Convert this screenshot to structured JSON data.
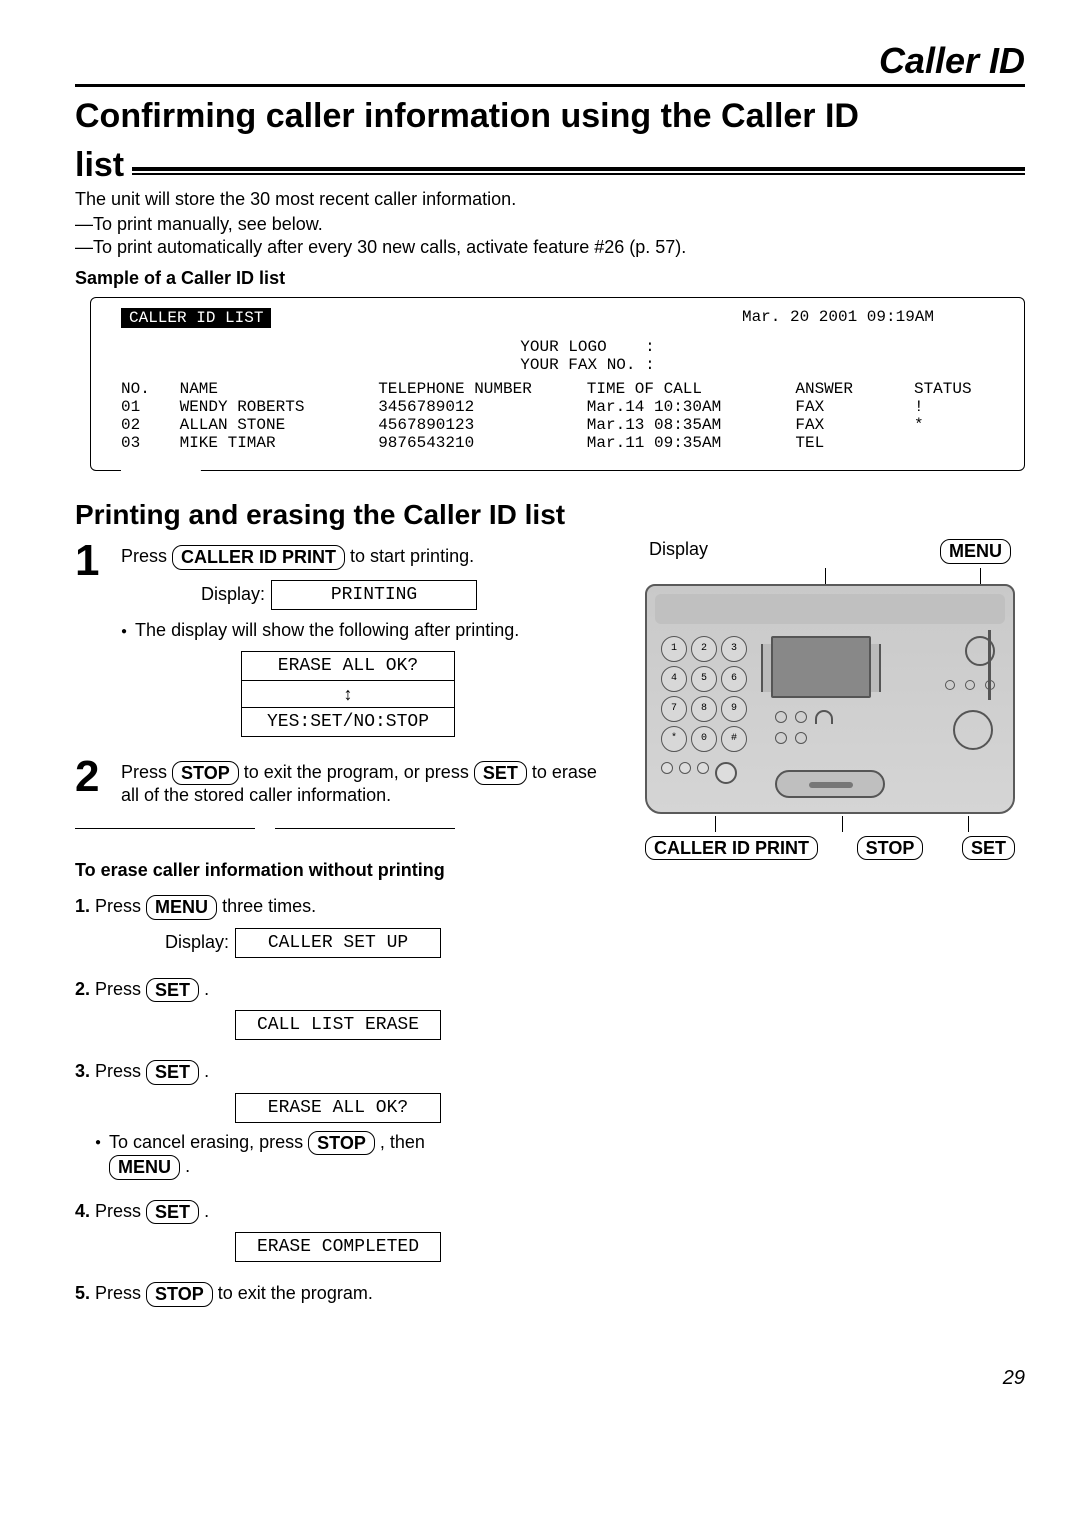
{
  "header": "Caller ID",
  "title": "Confirming caller information using the Caller ID list",
  "intro": {
    "line1": "The unit will store the 30 most recent caller information.",
    "line2": "—To print manually, see below.",
    "line3": "—To print automatically after every 30 new calls, activate feature #26 (p. 57).",
    "sample_label": "Sample of a Caller ID list"
  },
  "sample": {
    "badge": "CALLER ID LIST",
    "date": "Mar. 20 2001 09:19AM",
    "logo": "YOUR LOGO    :",
    "faxno": "YOUR FAX NO. :",
    "cols": {
      "no": "NO.",
      "name": "NAME",
      "tel": "TELEPHONE NUMBER",
      "time": "TIME OF CALL",
      "ans": "ANSWER",
      "stat": "STATUS"
    },
    "rows": [
      {
        "no": "01",
        "name": "WENDY ROBERTS",
        "tel": "3456789012",
        "time": "Mar.14 10:30AM",
        "ans": "FAX",
        "stat": "!"
      },
      {
        "no": "02",
        "name": "ALLAN STONE",
        "tel": "4567890123",
        "time": "Mar.13 08:35AM",
        "ans": "FAX",
        "stat": "*"
      },
      {
        "no": "03",
        "name": "MIKE TIMAR",
        "tel": "9876543210",
        "time": "Mar.11 09:35AM",
        "ans": "TEL",
        "stat": ""
      }
    ]
  },
  "sub_heading": "Printing and erasing the Caller ID list",
  "steps": {
    "s1": {
      "pre": "Press ",
      "btn": "CALLER ID PRINT",
      "post": " to start printing.",
      "display_label": "Display:",
      "display_val": "PRINTING",
      "after": "The display will show the following after printing.",
      "box1": "ERASE ALL OK?",
      "box3": "YES:SET/NO:STOP"
    },
    "s2": {
      "pre": "Press ",
      "btn1": "STOP",
      "mid": " to exit the program, or press ",
      "btn2": "SET",
      "post": " to erase all of the stored caller information."
    }
  },
  "erase": {
    "heading": "To erase caller information without printing",
    "i1_pre": "Press ",
    "i1_btn": "MENU",
    "i1_post": " three times.",
    "i1_label": "Display:",
    "i1_val": "CALLER SET UP",
    "i2_pre": "Press ",
    "i2_btn": "SET",
    "i2_post": ".",
    "i2_val": "CALL LIST ERASE",
    "i3_pre": "Press ",
    "i3_btn": "SET",
    "i3_post": ".",
    "i3_val": "ERASE ALL OK?",
    "i3_note_pre": "To cancel erasing, press ",
    "i3_note_btn": "STOP",
    "i3_note_mid": ", then ",
    "i3_note_btn2": "MENU",
    "i3_note_post": ".",
    "i4_pre": "Press ",
    "i4_btn": "SET",
    "i4_post": ".",
    "i4_val": "ERASE COMPLETED",
    "i5_pre": "Press ",
    "i5_btn": "STOP",
    "i5_post": " to exit the program."
  },
  "device": {
    "top_left": "Display",
    "top_right": "MENU",
    "bot_1": "CALLER ID PRINT",
    "bot_2": "STOP",
    "bot_3": "SET",
    "keys": [
      "1",
      "2",
      "3",
      "4",
      "5",
      "6",
      "7",
      "8",
      "9",
      "*",
      "0",
      "#"
    ]
  },
  "page": "29"
}
